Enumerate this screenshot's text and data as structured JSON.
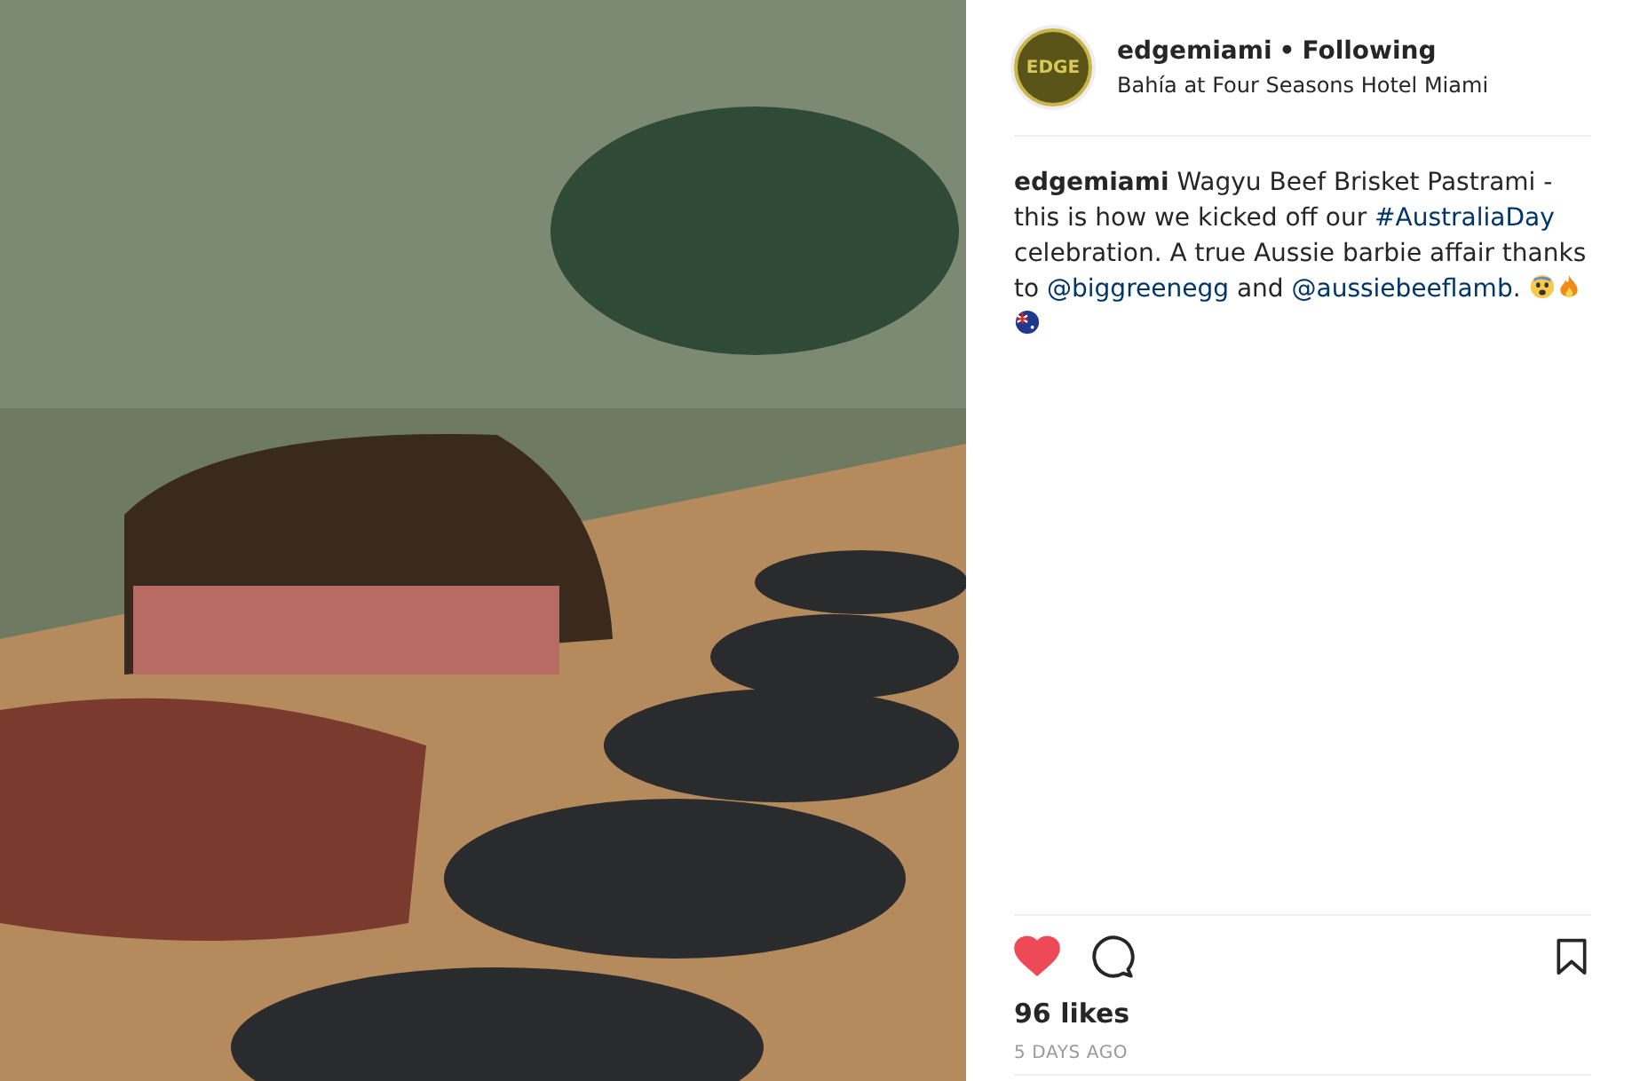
{
  "post": {
    "username": "edgemiami",
    "separator": "•",
    "follow_status": "Following",
    "location": "Bahía at Four Seasons Hotel Miami",
    "avatar_text": "EDGE"
  },
  "caption": [
    {
      "kind": "user",
      "text": "edgemiami"
    },
    {
      "kind": "text",
      "text": " Wagyu Beef Brisket Pastrami - this is how we kicked off our "
    },
    {
      "kind": "link",
      "text": "#AustraliaDay"
    },
    {
      "kind": "text",
      "text": " celebration. A true Aussie barbie affair thanks to "
    },
    {
      "kind": "link",
      "text": "@biggreenegg"
    },
    {
      "kind": "text",
      "text": " and "
    },
    {
      "kind": "link",
      "text": "@aussiebeeflamb"
    },
    {
      "kind": "text",
      "text": "."
    }
  ],
  "actions": {
    "liked": true,
    "saved": false
  },
  "likes": "96 likes",
  "timestamp": "5 DAYS AGO"
}
